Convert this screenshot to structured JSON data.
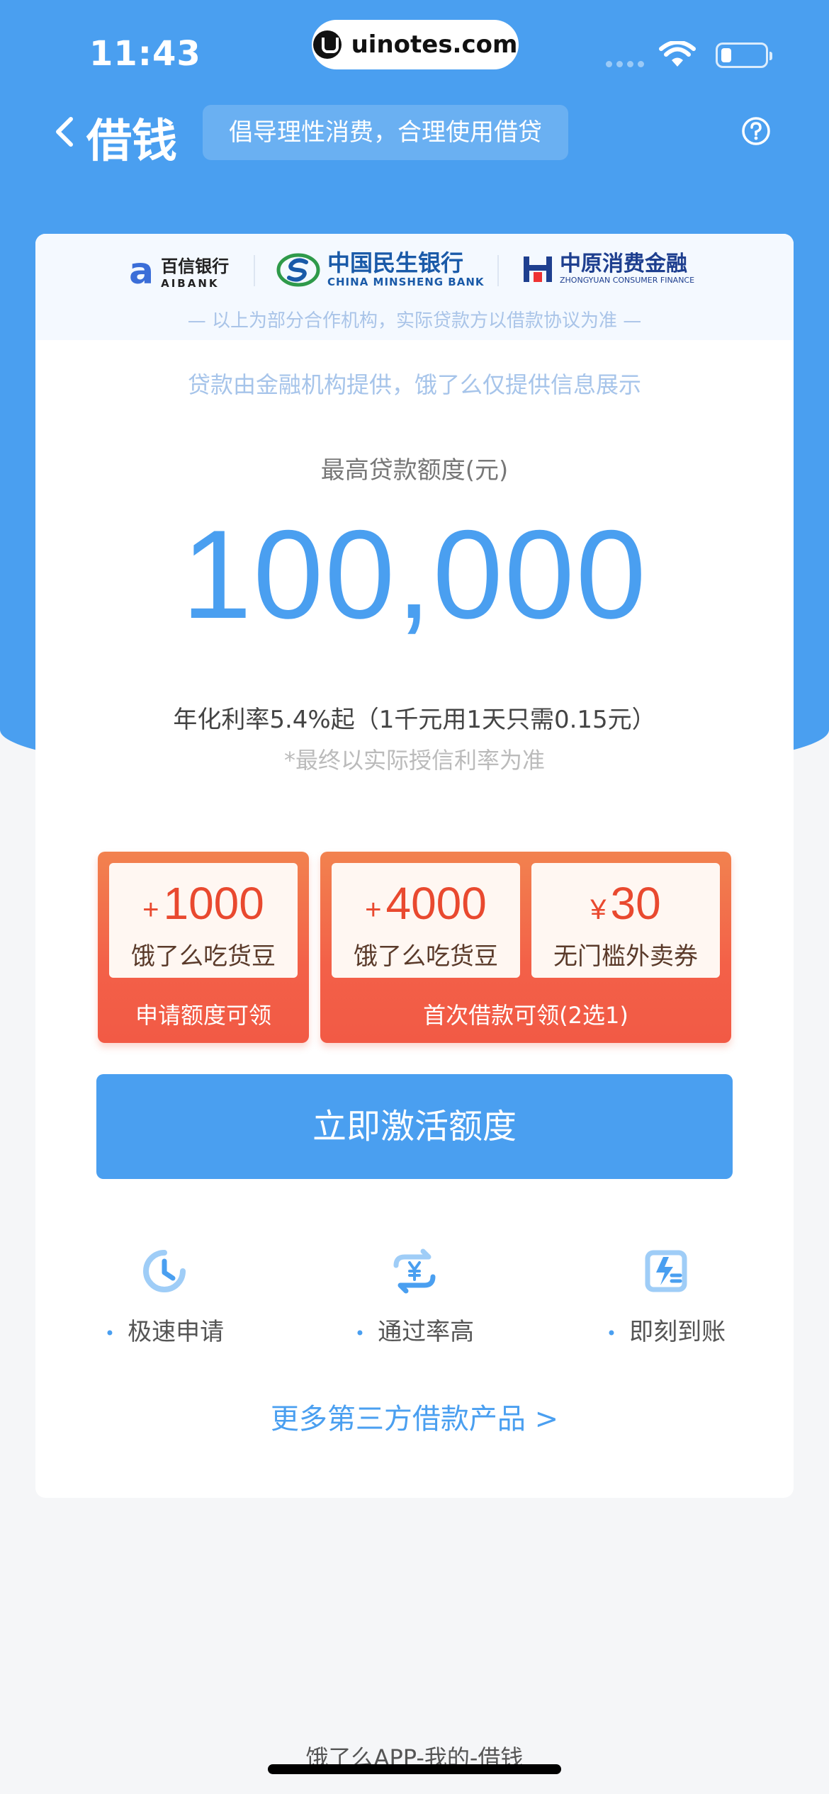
{
  "status_bar": {
    "time": "11:43",
    "url": "uinotes.com"
  },
  "nav": {
    "title": "借钱",
    "tagline": "倡导理性消费，合理使用借贷"
  },
  "partners": {
    "logos": [
      {
        "cn": "百信银行",
        "en": "AIBANK",
        "mark": "a"
      },
      {
        "cn": "中国民生银行",
        "en": "CHINA MINSHENG BANK"
      },
      {
        "cn": "中原消费金融",
        "en": "ZHONGYUAN CONSUMER FINANCE"
      }
    ],
    "note": "— 以上为部分合作机构，实际贷款方以借款协议为准 —"
  },
  "loan": {
    "disclaimer": "贷款由金融机构提供，饿了么仅提供信息展示",
    "limit_label": "最高贷款额度(元)",
    "limit_value": "100,000",
    "rate_line": "年化利率5.4%起（1千元用1天只需0.15元）",
    "rate_note": "*最终以实际授信利率为准"
  },
  "rewards": {
    "left": {
      "prefix": "+",
      "amount": "1000",
      "desc": "饿了么吃货豆",
      "caption": "申请额度可领"
    },
    "right": {
      "coupons": [
        {
          "prefix": "+",
          "amount": "4000",
          "desc": "饿了么吃货豆"
        },
        {
          "prefix": "¥",
          "amount": "30",
          "desc": "无门槛外卖券"
        }
      ],
      "caption": "首次借款可领(2选1)"
    }
  },
  "cta": {
    "label": "立即激活额度"
  },
  "features": [
    {
      "label": "极速申请",
      "icon": "clock-icon"
    },
    {
      "label": "通过率高",
      "icon": "yuan-exchange-icon"
    },
    {
      "label": "即刻到账",
      "icon": "flash-arrival-icon"
    }
  ],
  "more_link": "更多第三方借款产品 >",
  "footer_caption": "饿了么APP-我的-借钱",
  "colors": {
    "primary": "#4a9ff0",
    "reward": "#f36048",
    "coupon_text": "#e9492f"
  }
}
